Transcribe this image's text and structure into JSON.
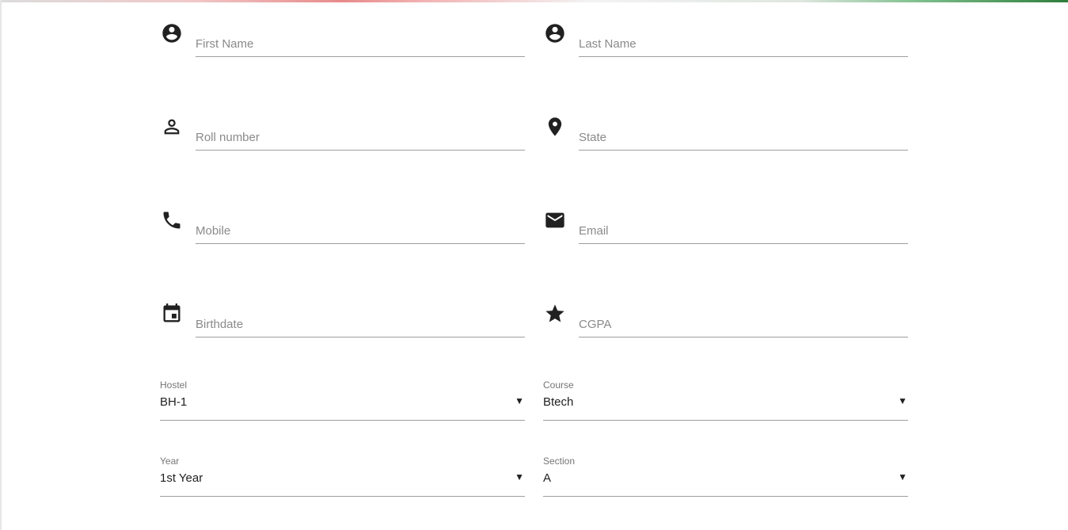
{
  "form": {
    "fields": {
      "first_name": {
        "placeholder": "First Name",
        "icon": "account-circle-icon"
      },
      "last_name": {
        "placeholder": "Last Name",
        "icon": "account-circle-icon"
      },
      "roll_number": {
        "placeholder": "Roll number",
        "icon": "person-outline-icon"
      },
      "state": {
        "placeholder": "State",
        "icon": "location-pin-icon"
      },
      "mobile": {
        "placeholder": "Mobile",
        "icon": "phone-icon"
      },
      "email": {
        "placeholder": "Email",
        "icon": "mail-icon"
      },
      "birthdate": {
        "placeholder": "Birthdate",
        "icon": "calendar-icon"
      },
      "cgpa": {
        "placeholder": "CGPA",
        "icon": "star-icon"
      }
    },
    "selects": {
      "hostel": {
        "label": "Hostel",
        "value": "BH-1"
      },
      "course": {
        "label": "Course",
        "value": "Btech"
      },
      "year": {
        "label": "Year",
        "value": "1st Year"
      },
      "section": {
        "label": "Section",
        "value": "A"
      }
    },
    "dropdown_arrow": "▼"
  },
  "colors": {
    "icon": "#212121",
    "underline": "#9e9e9e",
    "placeholder": "#8a8a8a",
    "label": "#757575"
  }
}
